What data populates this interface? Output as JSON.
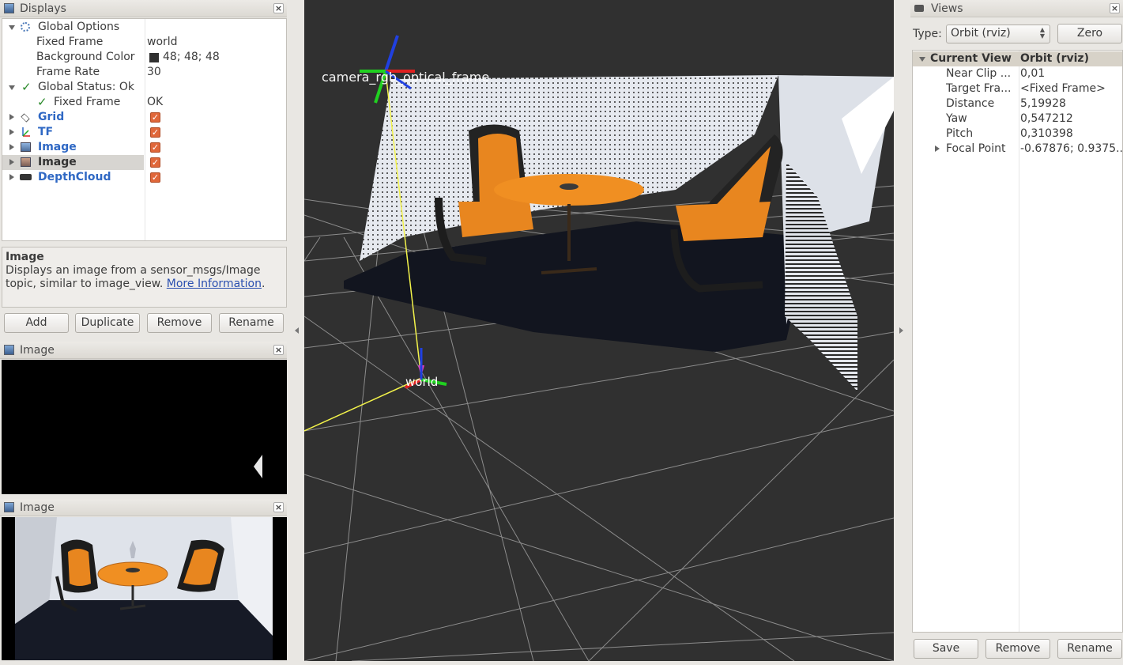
{
  "displays": {
    "title": "Displays",
    "rows": [
      {
        "name": "Global Options",
        "value": ""
      },
      {
        "name": "Fixed Frame",
        "value": "world"
      },
      {
        "name": "Background Color",
        "value": "48; 48; 48"
      },
      {
        "name": "Frame Rate",
        "value": "30"
      },
      {
        "name": "Global Status: Ok",
        "value": ""
      },
      {
        "name": "Fixed Frame",
        "value": "OK"
      },
      {
        "name": "Grid",
        "value": ""
      },
      {
        "name": "TF",
        "value": ""
      },
      {
        "name": "Image",
        "value": ""
      },
      {
        "name": "Image",
        "value": ""
      },
      {
        "name": "DepthCloud",
        "value": ""
      }
    ],
    "description_title": "Image",
    "description_text": "Displays an image from a sensor_msgs/Image topic, similar to image_view. ",
    "description_link": "More Information",
    "description_end": ".",
    "buttons": {
      "add": "Add",
      "duplicate": "Duplicate",
      "remove": "Remove",
      "rename": "Rename"
    },
    "background_color": "#303030"
  },
  "image_panels": [
    {
      "title": "Image"
    },
    {
      "title": "Image"
    }
  ],
  "viewport": {
    "frame_labels": {
      "world": "world",
      "camera": "camera_rgb_optical_frame"
    },
    "background": "#303030"
  },
  "views": {
    "title": "Views",
    "type_label": "Type:",
    "type_value": "Orbit (rviz)",
    "zero_button": "Zero",
    "header": {
      "name": "Current View",
      "value": "Orbit (rviz)"
    },
    "rows": [
      {
        "name": "Near Clip ...",
        "value": "0,01"
      },
      {
        "name": "Target Fra...",
        "value": "<Fixed Frame>"
      },
      {
        "name": "Distance",
        "value": "5,19928"
      },
      {
        "name": "Yaw",
        "value": "0,547212"
      },
      {
        "name": "Pitch",
        "value": "0,310398"
      },
      {
        "name": "Focal Point",
        "value": "-0.67876; 0.9375..."
      }
    ],
    "buttons": {
      "save": "Save",
      "remove": "Remove",
      "rename": "Rename"
    }
  }
}
